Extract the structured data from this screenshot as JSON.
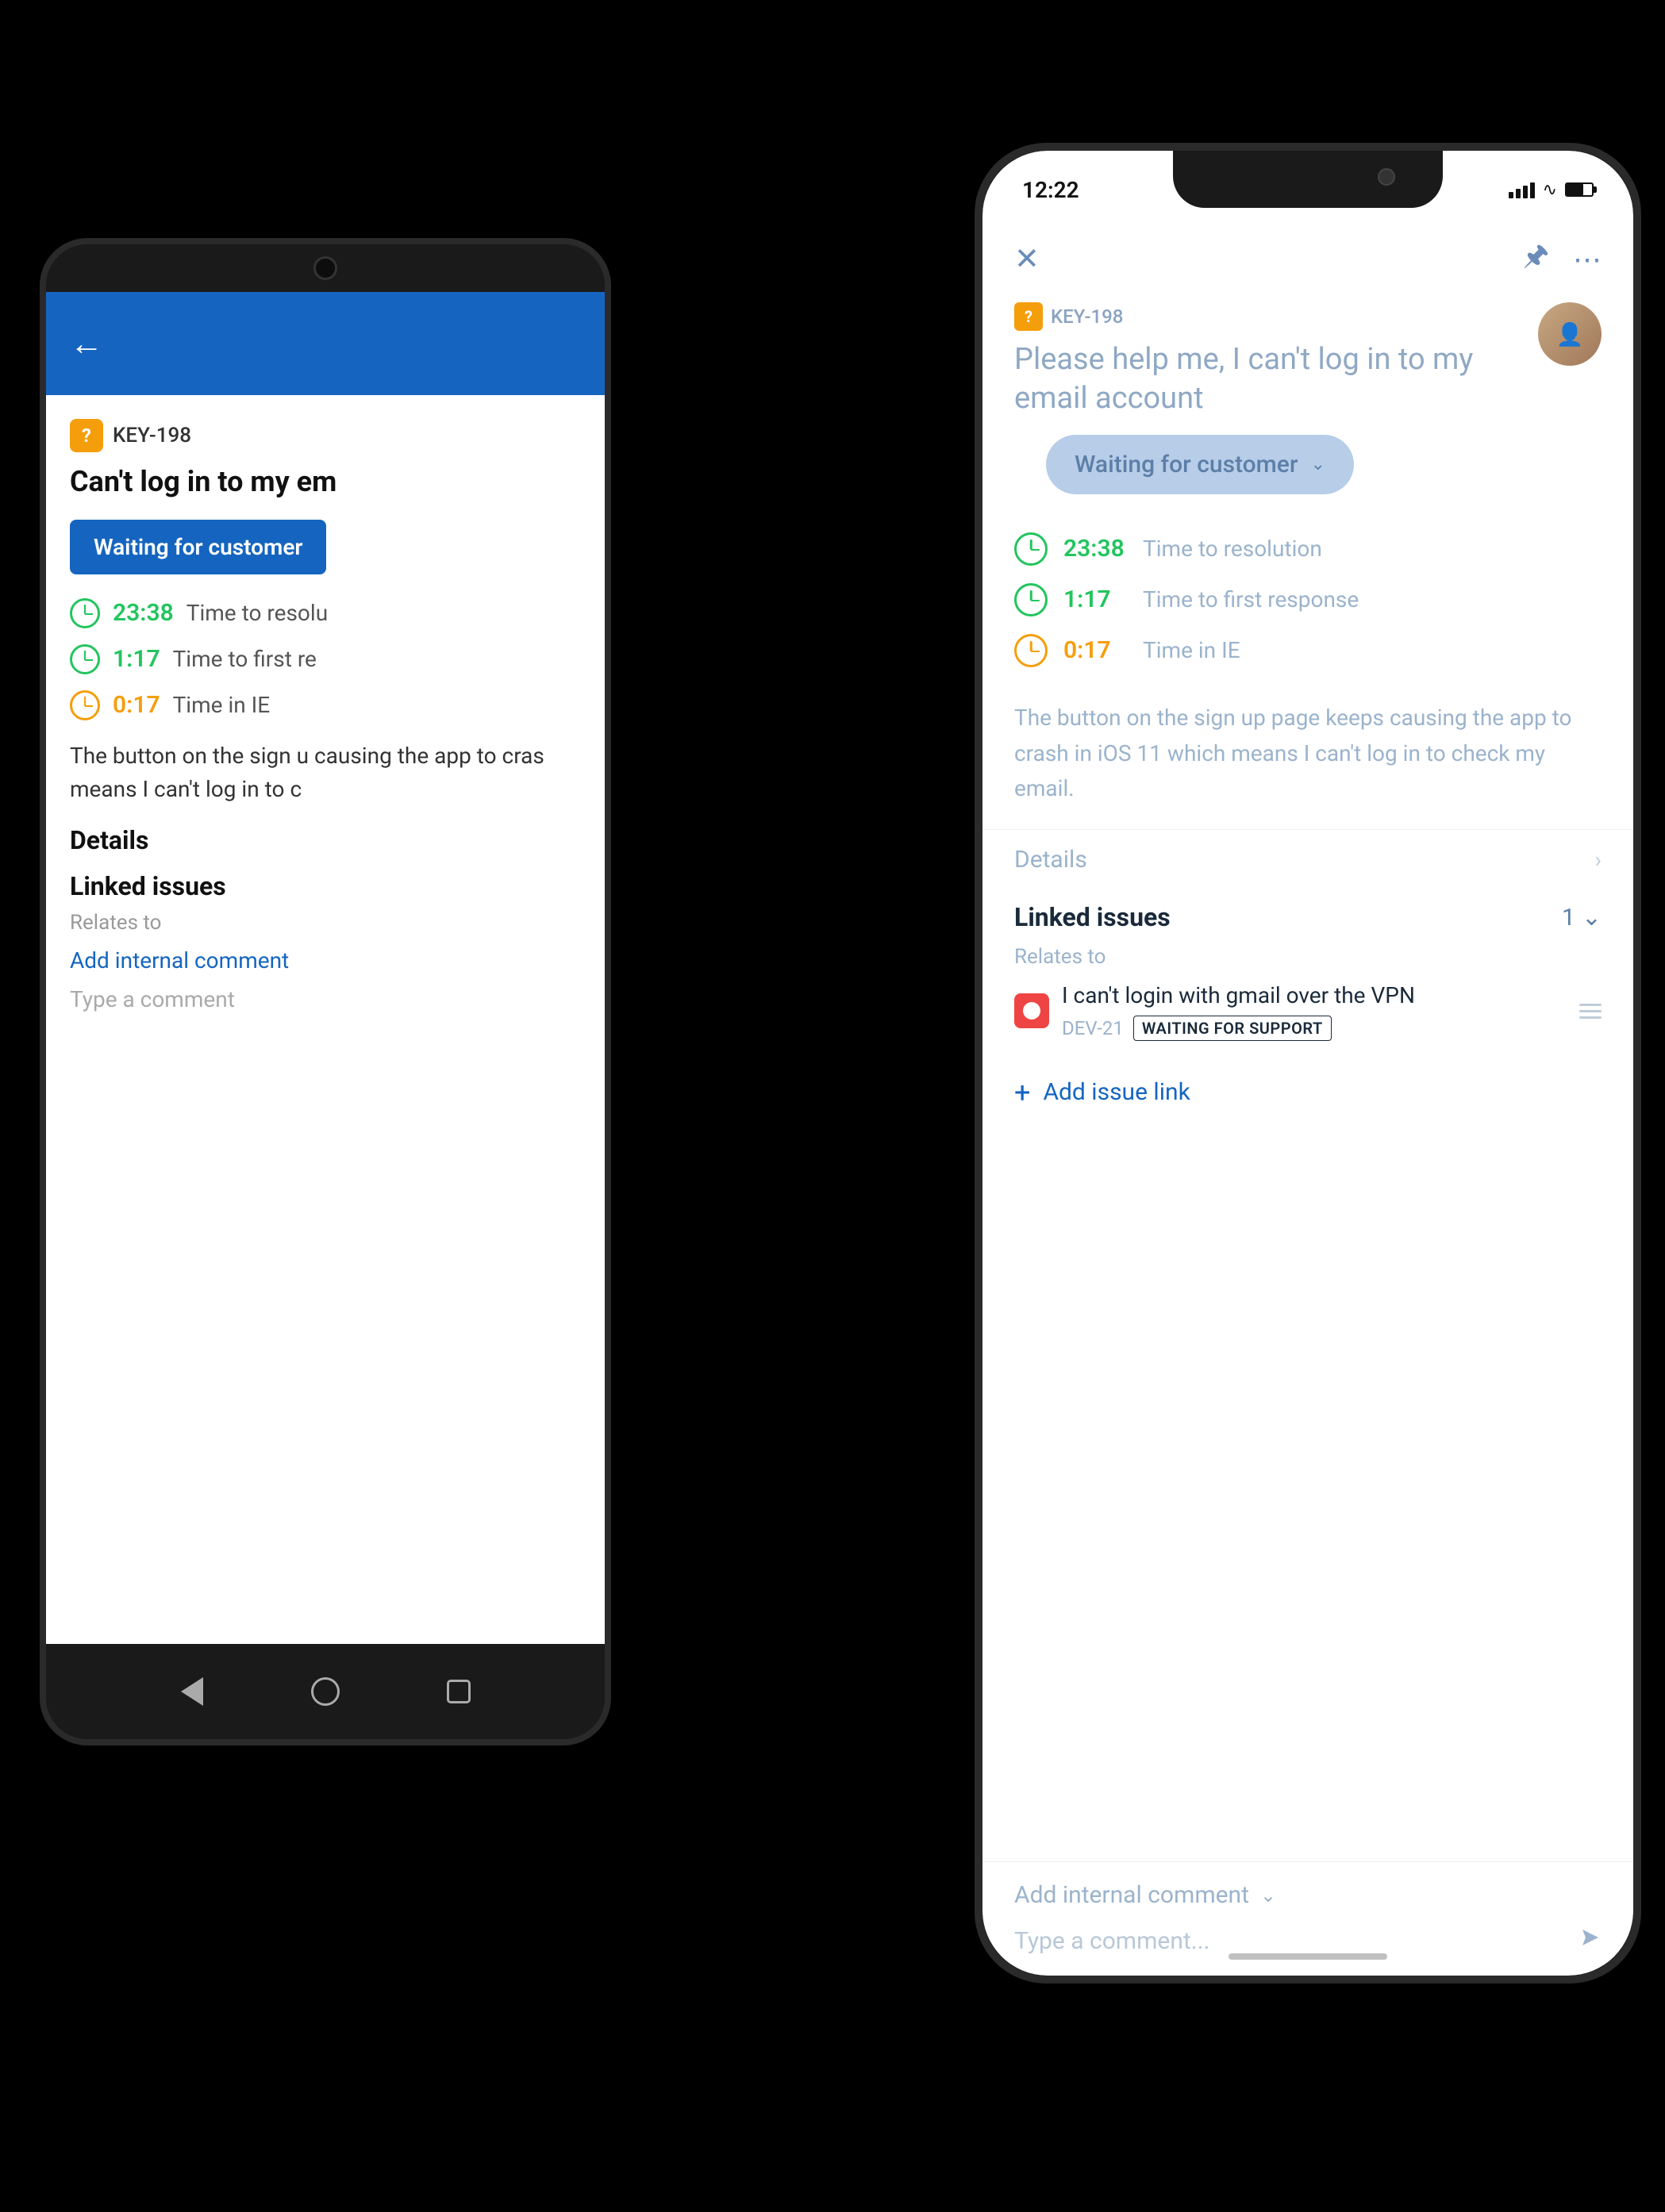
{
  "android": {
    "key_id": "KEY-198",
    "title": "Can't log in to my em",
    "status": "Waiting for customer",
    "times": [
      {
        "value": "23:38",
        "label": "Time to resolu",
        "color": "green"
      },
      {
        "value": "1:17",
        "label": "Time to first re",
        "color": "green"
      },
      {
        "value": "0:17",
        "label": "Time in IE",
        "color": "orange"
      }
    ],
    "description": "The button on the sign u causing the app to cras means I can't log in to c",
    "details_label": "Details",
    "linked_issues_label": "Linked issues",
    "relates_to": "Relates to",
    "add_comment": "Add internal comment",
    "type_comment": "Type a comment"
  },
  "ios": {
    "status_time": "12:22",
    "key_id": "KEY-198",
    "title": "Please help me, I can't log in to my email account",
    "status": "Waiting for customer",
    "times": [
      {
        "value": "23:38",
        "label": "Time to resolution",
        "color": "green"
      },
      {
        "value": "1:17",
        "label": "Time to first response",
        "color": "green"
      },
      {
        "value": "0:17",
        "label": "Time in IE",
        "color": "orange"
      }
    ],
    "description": "The button on the sign up page keeps causing the app to crash in iOS 11 which means I can't log in to check my email.",
    "details_label": "Details",
    "linked_issues_label": "Linked issues",
    "linked_count": "1",
    "relates_to": "Relates to",
    "linked_issue": {
      "title": "I can't login with gmail over the VPN",
      "key": "DEV-21",
      "badge": "WAITING FOR SUPPORT"
    },
    "add_issue_link": "Add issue link",
    "add_internal_comment": "Add internal comment",
    "type_comment": "Type a comment..."
  }
}
